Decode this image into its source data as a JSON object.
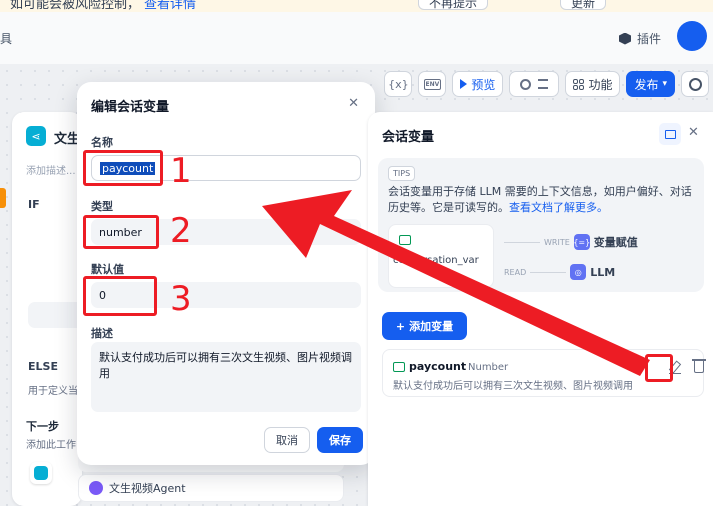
{
  "banner": {
    "text": "如可能会被风险控制，",
    "link": "查看详情",
    "btn1": "不再提示",
    "btn2": "更新"
  },
  "header": {
    "left_label": "具",
    "plugin_label": "插件"
  },
  "toolbar": {
    "env_label": "ENV",
    "preview_label": "预览",
    "features_label": "功能",
    "publish_label": "发布"
  },
  "left_node": {
    "title": "文生",
    "desc": "添加描述...",
    "if_label": "IF",
    "else_label": "ELSE",
    "else_desc": "用于定义当",
    "next_label": "下一步",
    "next_desc": "添加此工作"
  },
  "agent_row": {
    "label": "文生视频Agent"
  },
  "modal": {
    "title": "编辑会话变量",
    "name_label": "名称",
    "name_value": "paycount",
    "type_label": "类型",
    "type_value": "number",
    "default_label": "默认值",
    "default_value": "0",
    "desc_label": "描述",
    "desc_value": "默认支付成功后可以拥有三次文生视频、图片视频调用",
    "cancel_label": "取消",
    "save_label": "保存"
  },
  "annotations": [
    "1",
    "2",
    "3"
  ],
  "right_panel": {
    "title": "会话变量",
    "tips_tag": "TIPS",
    "tips_text": "会话变量用于存储 LLM 需要的上下文信息，如用户偏好、对话历史等。它是可读写的。",
    "tips_link": "查看文档了解更多。",
    "card_var_name": "conversation_var",
    "write_label": "WRITE",
    "write_target": "变量赋值",
    "read_label": "READ",
    "read_target": "LLM",
    "add_button": "添加变量",
    "var_item": {
      "name": "paycount",
      "type": "Number",
      "desc": "默认支付成功后可以拥有三次文生视频、图片视频调用"
    }
  },
  "colors": {
    "primary": "#155eef",
    "annotation_red": "#ed1c24",
    "banner_bg": "#fef7e6"
  }
}
